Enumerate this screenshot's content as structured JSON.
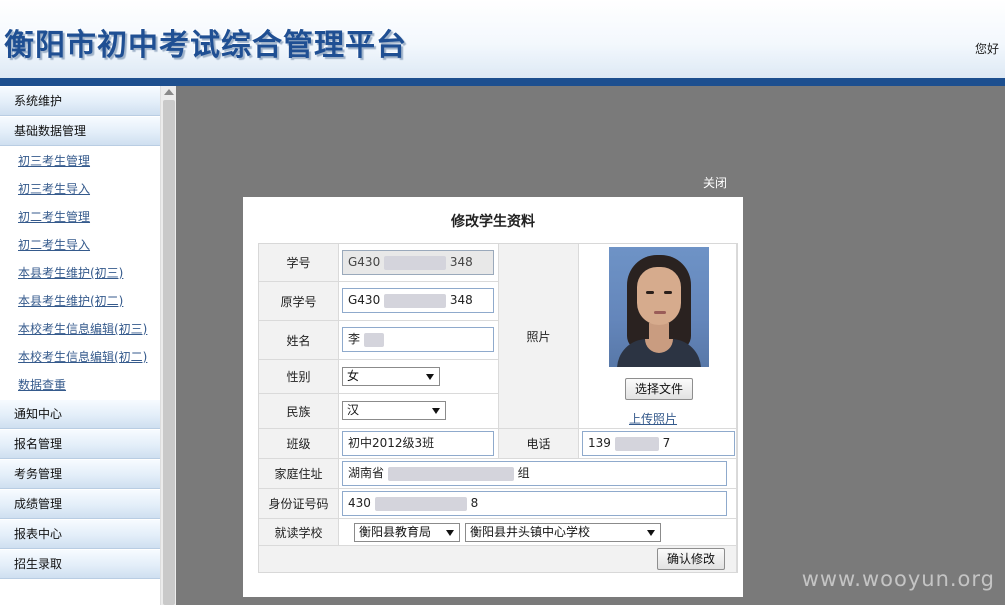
{
  "header": {
    "title": "衡阳市初中考试综合管理平台",
    "greeting": "您好"
  },
  "sidebar": {
    "sections": [
      {
        "label": "系统维护"
      },
      {
        "label": "基础数据管理"
      }
    ],
    "sub_items": [
      {
        "label": "初三考生管理"
      },
      {
        "label": "初三考生导入"
      },
      {
        "label": "初二考生管理"
      },
      {
        "label": "初二考生导入"
      },
      {
        "label": "本县考生维护(初三)"
      },
      {
        "label": "本县考生维护(初二)"
      },
      {
        "label": "本校考生信息编辑(初三)"
      },
      {
        "label": "本校考生信息编辑(初二)"
      },
      {
        "label": "数据查重"
      }
    ],
    "sections_bottom": [
      {
        "label": "通知中心"
      },
      {
        "label": "报名管理"
      },
      {
        "label": "考务管理"
      },
      {
        "label": "成绩管理"
      },
      {
        "label": "报表中心"
      },
      {
        "label": "招生录取"
      }
    ]
  },
  "dialog": {
    "close_label": "关闭",
    "title": "修改学生资料",
    "fields": {
      "student_no": {
        "label": "学号",
        "value_prefix": "G430",
        "value_suffix": "348"
      },
      "original_no": {
        "label": "原学号",
        "value_prefix": "G430",
        "value_suffix": "348"
      },
      "name": {
        "label": "姓名",
        "value_prefix": "李"
      },
      "gender": {
        "label": "性别",
        "value": "女"
      },
      "ethnicity": {
        "label": "民族",
        "value": "汉"
      },
      "photo": {
        "label": "照片",
        "choose_button": "选择文件",
        "upload_link": "上传照片"
      },
      "class": {
        "label": "班级",
        "value": "初中2012级3班"
      },
      "phone": {
        "label": "电话",
        "value_prefix": "139",
        "value_suffix": "7"
      },
      "address": {
        "label": "家庭住址",
        "value_prefix": "湖南省",
        "value_suffix": "组"
      },
      "id_card": {
        "label": "身份证号码",
        "value_prefix": "430",
        "value_suffix": "8"
      },
      "school": {
        "label": "就读学校",
        "bureau": "衡阳县教育局",
        "school": "衡阳县井头镇中心学校"
      }
    },
    "confirm_button": "确认修改"
  },
  "watermark": "www.wooyun.org"
}
